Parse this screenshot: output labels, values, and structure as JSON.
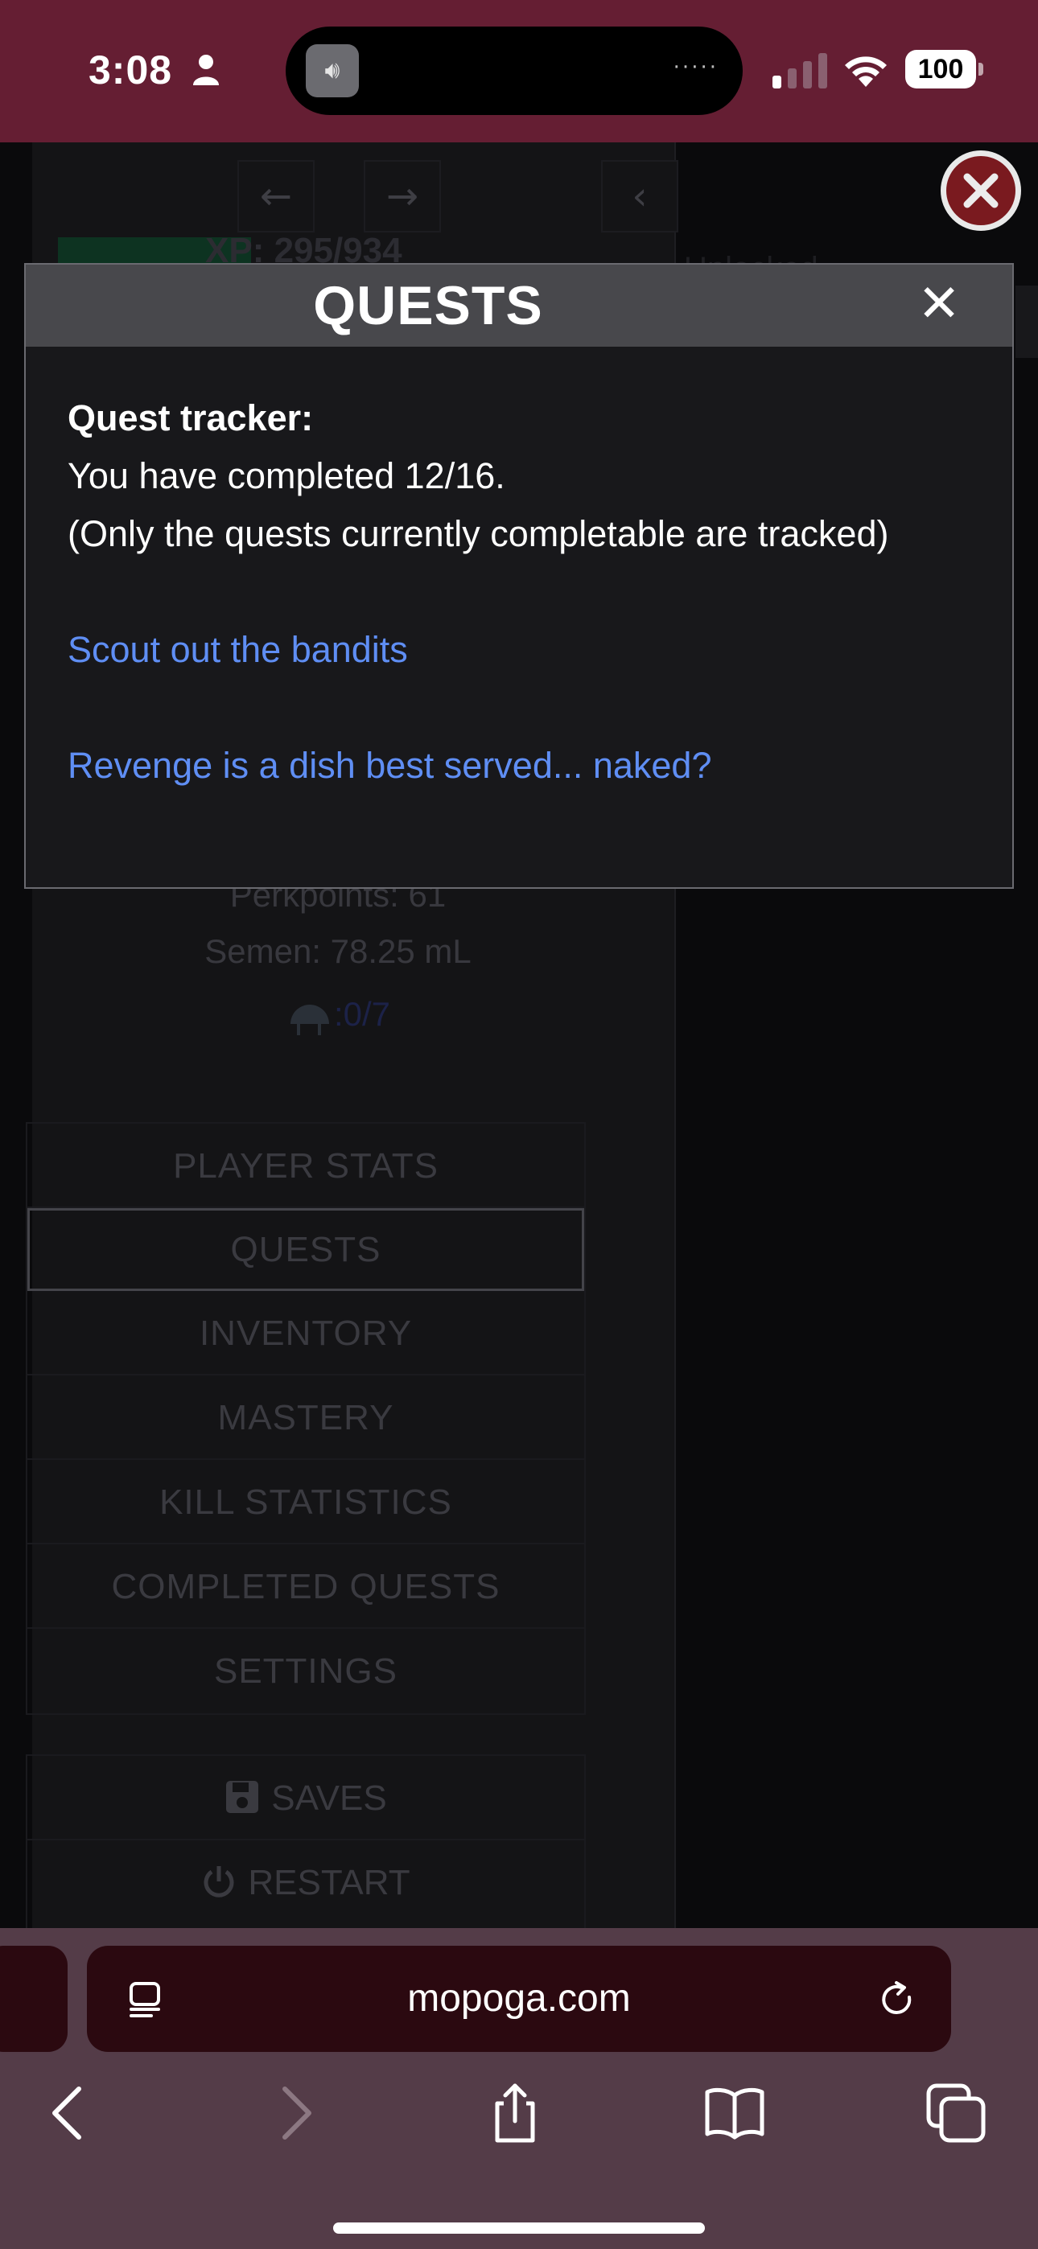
{
  "status_bar": {
    "time": "3:08",
    "battery": "100"
  },
  "background": {
    "xp_label": "XP: 295/934",
    "side_text": "Unlocked",
    "perkpoints": "Perkpoints: 61",
    "semen": "Semen: 78.25 mL",
    "helmet_count": ":0/7",
    "menu_items": [
      "PLAYER STATS",
      "QUESTS",
      "INVENTORY",
      "MASTERY",
      "KILL STATISTICS",
      "COMPLETED QUESTS",
      "SETTINGS"
    ],
    "active_menu": "QUESTS",
    "secondary_items": [
      "SAVES",
      "RESTART"
    ]
  },
  "dialog": {
    "title": "QUESTS",
    "close_glyph": "✕",
    "tracker_heading": "Quest tracker:",
    "completed_text": "You have completed 12/16.",
    "note_text": "(Only the quests currently completable are tracked)",
    "quests": [
      "Scout out the bandits",
      "Revenge is a dish best served... naked?"
    ]
  },
  "browser": {
    "url": "mopoga.com"
  },
  "colors": {
    "status_bar": "#651e33",
    "link": "#5f8ef4",
    "dialog_header": "#48484c",
    "dialog_bg": "#18181b",
    "safari_bar": "#543c48"
  },
  "icons": [
    "person-icon",
    "speaker-icon",
    "signal-icon",
    "wifi-icon",
    "battery-icon",
    "arrow-left-icon",
    "arrow-right-icon",
    "chevron-left-icon",
    "close-circle-icon",
    "helmet-icon",
    "save-icon",
    "power-icon",
    "reader-icon",
    "reload-icon",
    "back-icon",
    "forward-icon",
    "share-icon",
    "bookmarks-icon",
    "tabs-icon"
  ]
}
